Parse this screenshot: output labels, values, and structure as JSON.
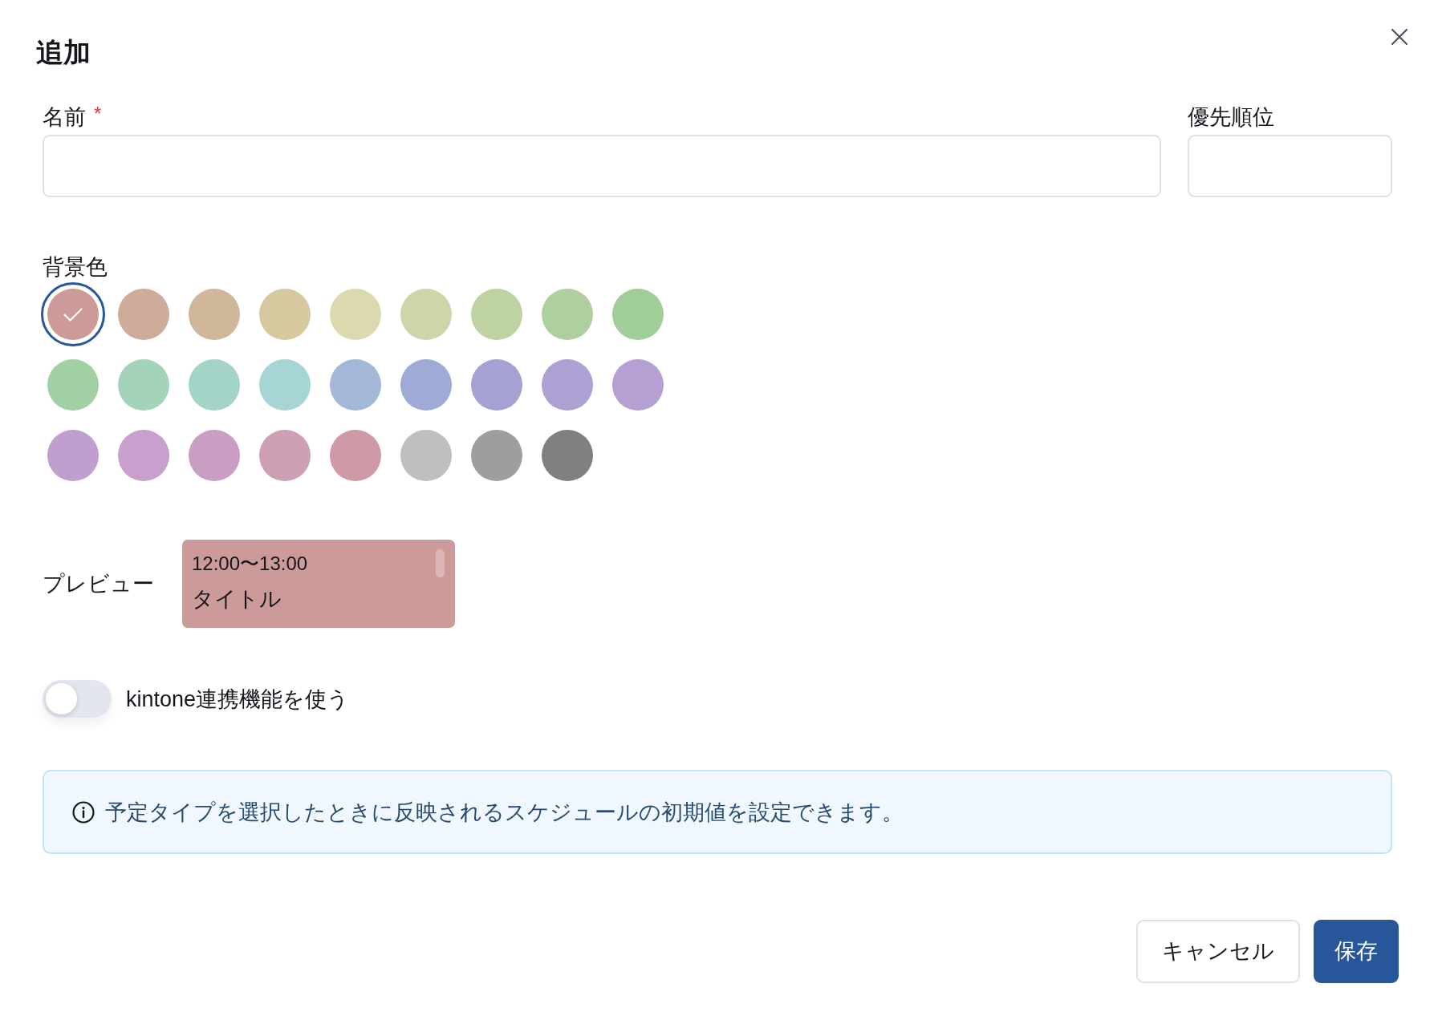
{
  "dialog": {
    "title": "追加"
  },
  "fields": [
    {
      "label": "名前",
      "required_mark": "*",
      "kind": "wide"
    },
    {
      "label": "優先順位",
      "kind": "narrow"
    }
  ],
  "background_color": {
    "label": "背景色",
    "swatches": [
      {
        "color": "#cc9a98",
        "selected": true
      },
      {
        "color": "#cfab9a",
        "selected": false
      },
      {
        "color": "#d0b69a",
        "selected": false
      },
      {
        "color": "#d6c9a0",
        "selected": false
      },
      {
        "color": "#dbdaae",
        "selected": false
      },
      {
        "color": "#ccd6a8",
        "selected": false
      },
      {
        "color": "#bed2a2",
        "selected": false
      },
      {
        "color": "#afcf9e",
        "selected": false
      },
      {
        "color": "#a1cd98",
        "selected": false
      },
      {
        "color": "#a1d0a5",
        "selected": false
      },
      {
        "color": "#a3d3b9",
        "selected": false
      },
      {
        "color": "#a4d3c8",
        "selected": false
      },
      {
        "color": "#a7d5d6",
        "selected": false
      },
      {
        "color": "#a2b8d6",
        "selected": false
      },
      {
        "color": "#9faad6",
        "selected": false
      },
      {
        "color": "#a3a2d3",
        "selected": false
      },
      {
        "color": "#ada0d2",
        "selected": false
      },
      {
        "color": "#b59fd3",
        "selected": false
      },
      {
        "color": "#bf9fcf",
        "selected": false
      },
      {
        "color": "#c99fce",
        "selected": false
      },
      {
        "color": "#cb9ec3",
        "selected": false
      },
      {
        "color": "#ce9fb5",
        "selected": false
      },
      {
        "color": "#cd9aa5",
        "selected": false
      },
      {
        "color": "#bfbfbf",
        "selected": false
      },
      {
        "color": "#9e9e9e",
        "selected": false
      },
      {
        "color": "#808080",
        "selected": false
      }
    ]
  },
  "preview": {
    "label": "プレビュー",
    "time": "12:00〜13:00",
    "title": "タイトル"
  },
  "kintone_toggle": {
    "label": "kintone連携機能を使う",
    "on": false
  },
  "info": {
    "text": "予定タイプを選択したときに反映されるスケジュールの初期値を設定できます。"
  },
  "buttons": [
    {
      "label": "キャンセル",
      "kind": "secondary"
    },
    {
      "label": "保存",
      "kind": "primary"
    }
  ]
}
